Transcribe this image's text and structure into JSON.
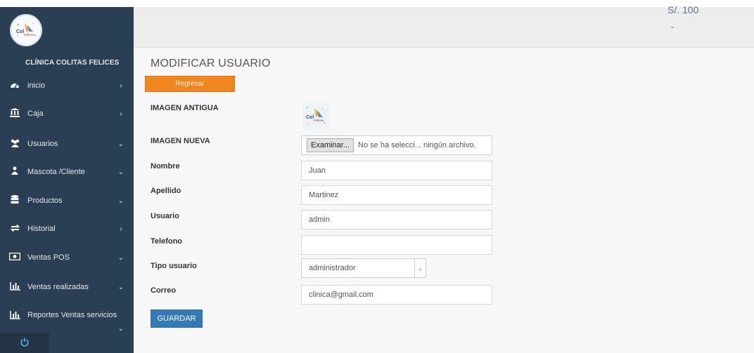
{
  "app": {
    "clinic_name": "CLÍNICA COLITAS FELICES",
    "logo_text": "Colitas Felices"
  },
  "header": {
    "balance": "S/. 100"
  },
  "sidebar": {
    "items": [
      {
        "label": "inicio",
        "icon": "dashboard-icon",
        "chevron": "›"
      },
      {
        "label": "Caja",
        "icon": "bank-icon",
        "chevron": "›"
      },
      {
        "label": "Usuarios",
        "icon": "users-icon",
        "chevron": "⌄"
      },
      {
        "label": "Mascota /Cliente",
        "icon": "pet-client-icon",
        "chevron": "⌄"
      },
      {
        "label": "Productos",
        "icon": "database-icon",
        "chevron": "⌄"
      },
      {
        "label": "Historial",
        "icon": "history-icon",
        "chevron": "›"
      },
      {
        "label": "Ventas POS",
        "icon": "money-icon",
        "chevron": "⌄"
      },
      {
        "label": "Ventas realizadas",
        "icon": "bar-chart-icon",
        "chevron": "⌄"
      },
      {
        "label": "Reportes Ventas servicios",
        "icon": "bar-chart-icon",
        "chevron": "⌄"
      }
    ]
  },
  "form": {
    "title": "MODIFICAR USUARIO",
    "back_label": "Regresar",
    "old_image_label": "IMAGEN ANTIGUA",
    "new_image_label": "IMAGEN NUEVA",
    "file_button": "Examinar...",
    "file_status": "No se ha selecci... ningún archivo.",
    "nombre_label": "Nombre",
    "nombre_value": "Juan",
    "apellido_label": "Apellido",
    "apellido_value": "Martinez",
    "usuario_label": "Usuario",
    "usuario_value": "admin",
    "telefono_label": "Telefono",
    "telefono_value": "",
    "tipo_label": "Tipo usuario",
    "tipo_value": "administrador",
    "correo_label": "Correo",
    "correo_value": "clinica@gmail.com",
    "save_label": "GUARDAR"
  },
  "colors": {
    "sidebar_bg": "#2a3f54",
    "back_button": "#f0861d",
    "save_button": "#337ab7"
  }
}
